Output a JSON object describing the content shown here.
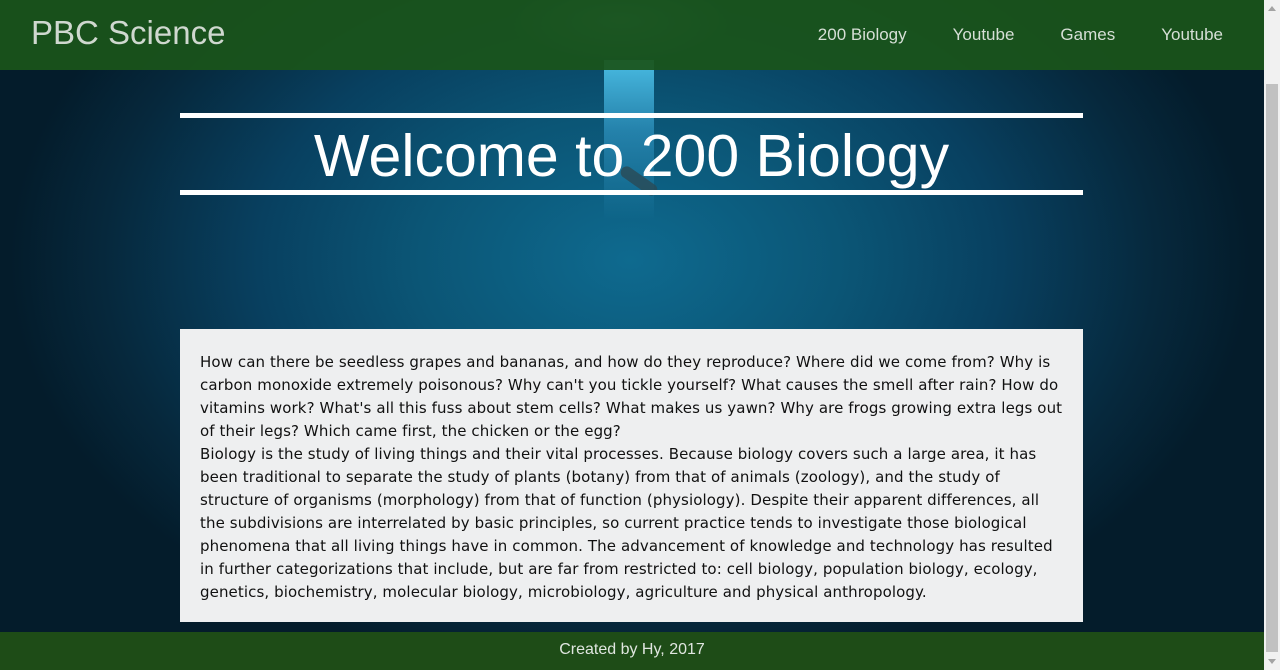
{
  "navbar": {
    "brand": "PBC Science",
    "links": [
      "200 Biology",
      "Youtube",
      "Games",
      "Youtube"
    ]
  },
  "hero": {
    "title": "Welcome to 200 Biology"
  },
  "content": {
    "paragraph1": "How can there be seedless grapes and bananas, and how do they reproduce? Where did we come from? Why is carbon monoxide extremely poisonous? Why can't you tickle yourself? What causes the smell after rain? How do vitamins work? What's all this fuss about stem cells? What makes us yawn? Why are frogs growing extra legs out of their legs? Which came first, the chicken or the egg?",
    "paragraph2": "Biology is the study of living things and their vital processes. Because biology covers such a large area, it has been traditional to separate the study of plants (botany) from that of animals (zoology), and the study of structure of organisms (morphology) from that of function (physiology). Despite their apparent differences, all the subdivisions are interrelated by basic principles, so current practice tends to investigate those biological phenomena that all living things have in common. The advancement of knowledge and technology has resulted in further categorizations that include, but are far from restricted to: cell biology, population biology, ecology, genetics, biochemistry, molecular biology, microbiology, agriculture and physical anthropology."
  },
  "footer": {
    "text": "Created by Hy, 2017"
  },
  "colors": {
    "navbar": "#1a541a",
    "footer": "#1e4c17",
    "card": "#eeeff0",
    "ocean": "#0b5575"
  },
  "icons": {
    "background": "underwater-diver-image"
  }
}
